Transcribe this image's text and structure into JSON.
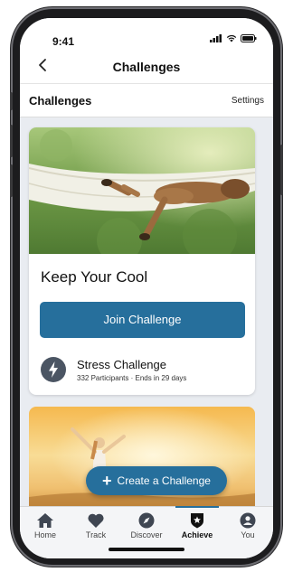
{
  "status": {
    "time": "9:41"
  },
  "nav": {
    "title": "Challenges"
  },
  "subheader": {
    "title": "Challenges",
    "settings": "Settings"
  },
  "card": {
    "title": "Keep Your Cool",
    "button": "Join Challenge",
    "challenge_name": "Stress Challenge",
    "challenge_meta": "332 Participants · Ends in 29 days"
  },
  "fab": {
    "label": "Create a Challenge"
  },
  "tabs": [
    {
      "label": "Home",
      "icon": "home-icon"
    },
    {
      "label": "Track",
      "icon": "heart-icon"
    },
    {
      "label": "Discover",
      "icon": "compass-icon"
    },
    {
      "label": "Achieve",
      "icon": "star-shield-icon"
    },
    {
      "label": "You",
      "icon": "user-icon"
    }
  ],
  "colors": {
    "accent": "#266f9c",
    "active_tab": "#111111"
  }
}
